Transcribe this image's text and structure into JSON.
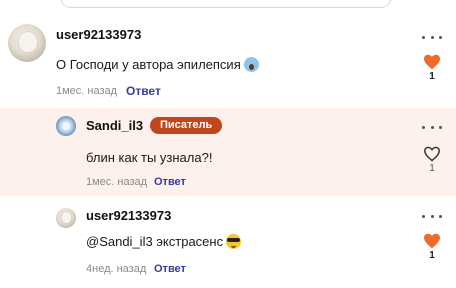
{
  "comments": [
    {
      "username": "user92133973",
      "text": "О Господи у автора эпилепсия",
      "emoji": "scream-emoji",
      "time": "1мес. назад",
      "reply_label": "Ответ",
      "likes": "1",
      "liked": true
    },
    {
      "username": "Sandi_il3",
      "badge": "Писатель",
      "text": "блин как ты узнала?!",
      "time": "1мес. назад",
      "reply_label": "Ответ",
      "likes": "1",
      "liked": false
    },
    {
      "username": "user92133973",
      "text": "@Sandi_il3 экстрасенс",
      "emoji": "sunglasses-emoji",
      "time": "4нед. назад",
      "reply_label": "Ответ",
      "likes": "1",
      "liked": true
    }
  ],
  "colors": {
    "accent_heart": "#f06a2c",
    "badge": "#c0461e",
    "reply_link": "#3a3aa3",
    "highlight_bg": "#fdf1ee"
  },
  "icons": {
    "more": "more-options-icon",
    "like_filled": "heart-filled-icon",
    "like_outline": "heart-outline-icon"
  }
}
